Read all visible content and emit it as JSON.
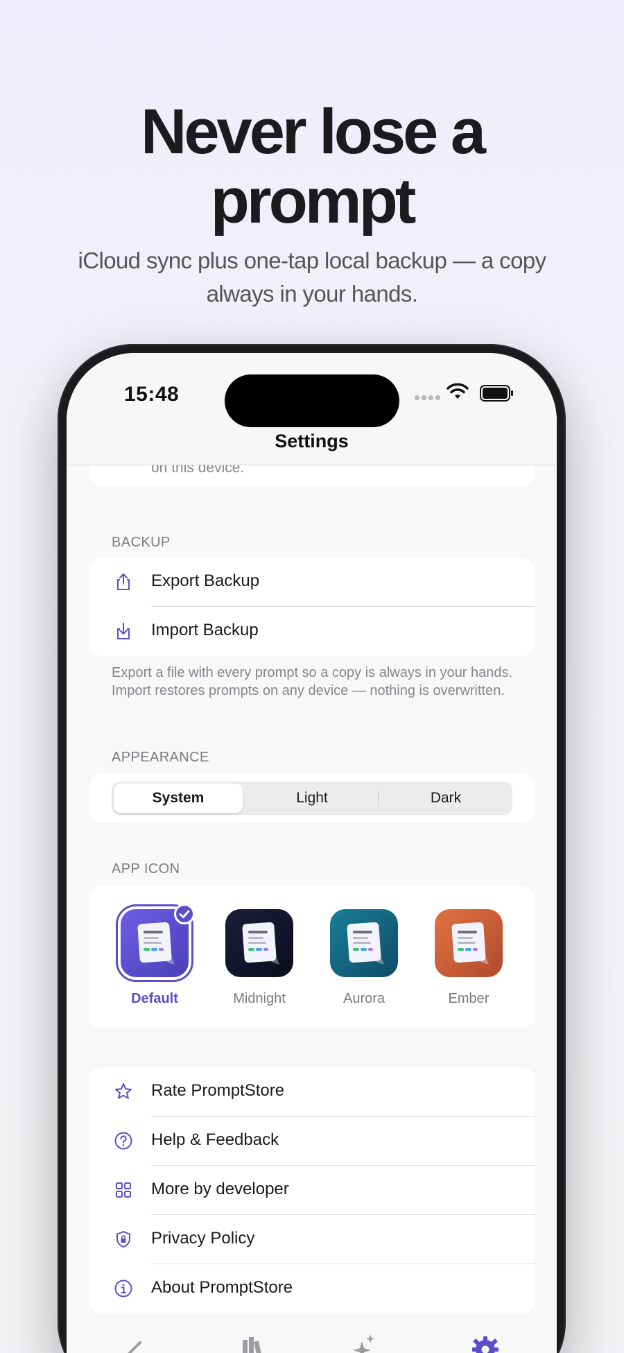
{
  "headline": {
    "line1": "Never lose a",
    "line2": "prompt"
  },
  "subline": {
    "line1": "iCloud sync plus one-tap local backup — a copy",
    "line2": "always in your hands."
  },
  "status": {
    "time": "15:48"
  },
  "nav": {
    "title": "Settings"
  },
  "cut_text": "on this device.",
  "backup": {
    "header": "BACKUP",
    "items": [
      {
        "label": "Export Backup",
        "icon": "share-export-icon"
      },
      {
        "label": "Import Backup",
        "icon": "download-import-icon"
      }
    ],
    "footnote": "Export a file with every prompt so a copy is always in your hands. Import restores prompts on any device — nothing is overwritten."
  },
  "appearance": {
    "header": "APPEARANCE",
    "options": [
      "System",
      "Light",
      "Dark"
    ],
    "selected": "System"
  },
  "app_icon": {
    "header": "APP ICON",
    "icons": [
      {
        "name": "Default",
        "selected": true,
        "color_a": "#6d5fe6",
        "color_b": "#4a3fb8"
      },
      {
        "name": "Midnight",
        "selected": false,
        "color_a": "#1c1e3a",
        "color_b": "#0c0d1e"
      },
      {
        "name": "Aurora",
        "selected": false,
        "color_a": "#1a7f95",
        "color_b": "#0e4a6b"
      },
      {
        "name": "Ember",
        "selected": false,
        "color_a": "#e17245",
        "color_b": "#b04a2c"
      }
    ]
  },
  "more": {
    "items": [
      {
        "label": "Rate PromptStore",
        "icon": "star-icon"
      },
      {
        "label": "Help & Feedback",
        "icon": "question-circle-icon"
      },
      {
        "label": "More by developer",
        "icon": "grid-apps-icon"
      },
      {
        "label": "Privacy Policy",
        "icon": "shield-lock-icon"
      },
      {
        "label": "About PromptStore",
        "icon": "info-circle-icon"
      }
    ]
  },
  "accent": "#5b4fc9"
}
